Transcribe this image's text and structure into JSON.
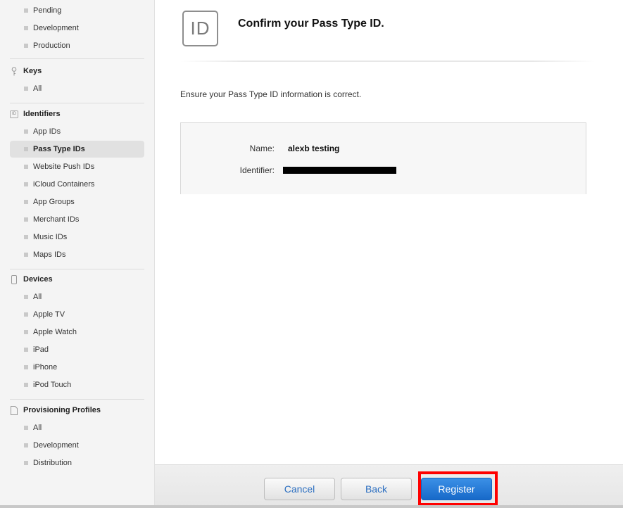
{
  "sidebar": {
    "certificates_items": [
      {
        "label": "Pending"
      },
      {
        "label": "Development"
      },
      {
        "label": "Production"
      }
    ],
    "keys": {
      "heading": "Keys",
      "icon": "key-icon",
      "items": [
        {
          "label": "All"
        }
      ]
    },
    "identifiers": {
      "heading": "Identifiers",
      "icon": "id-icon",
      "icon_text": "ID",
      "items": [
        {
          "label": "App IDs"
        },
        {
          "label": "Pass Type IDs",
          "selected": true
        },
        {
          "label": "Website Push IDs"
        },
        {
          "label": "iCloud Containers"
        },
        {
          "label": "App Groups"
        },
        {
          "label": "Merchant IDs"
        },
        {
          "label": "Music IDs"
        },
        {
          "label": "Maps IDs"
        }
      ]
    },
    "devices": {
      "heading": "Devices",
      "icon": "device-icon",
      "items": [
        {
          "label": "All"
        },
        {
          "label": "Apple TV"
        },
        {
          "label": "Apple Watch"
        },
        {
          "label": "iPad"
        },
        {
          "label": "iPhone"
        },
        {
          "label": "iPod Touch"
        }
      ]
    },
    "profiles": {
      "heading": "Provisioning Profiles",
      "icon": "document-icon",
      "items": [
        {
          "label": "All"
        },
        {
          "label": "Development"
        },
        {
          "label": "Distribution"
        }
      ]
    }
  },
  "main": {
    "badge_text": "ID",
    "title": "Confirm your Pass Type ID.",
    "intro": "Ensure your Pass Type ID information is correct.",
    "details": {
      "name_label": "Name:",
      "name_value": "alexb testing",
      "identifier_label": "Identifier:"
    }
  },
  "footer": {
    "cancel_label": "Cancel",
    "back_label": "Back",
    "register_label": "Register"
  },
  "colors": {
    "accent": "#2e70c1",
    "primary_button": "#1769c9",
    "highlight": "#ff0000"
  }
}
